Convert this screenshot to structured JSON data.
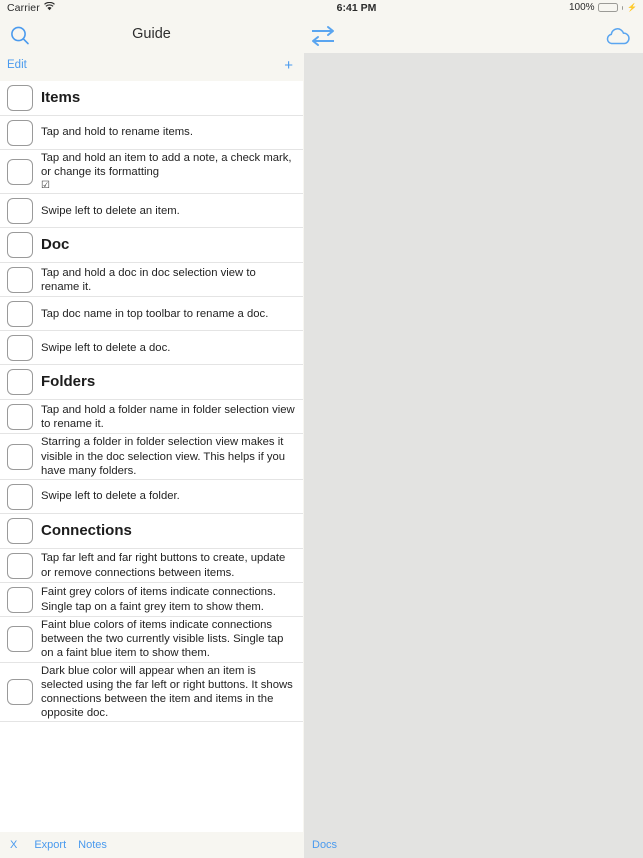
{
  "status_bar": {
    "carrier": "Carrier",
    "wifi_icon": "wifi-icon",
    "time": "6:41 PM",
    "battery_percent": "100%",
    "battery_icon": "battery-full-icon",
    "charging_icon": "charging-bolt-icon"
  },
  "nav_bar": {
    "search_icon": "search-icon",
    "title": "Guide",
    "sync_icon": "sync-arrows-icon",
    "cloud_icon": "cloud-icon"
  },
  "toolbar": {
    "edit_label": "Edit",
    "add_label": "+"
  },
  "colors": {
    "accent_blue": "#4a9aee",
    "background_cream": "#f7f6f1",
    "right_panel_grey": "#e3e3e1",
    "list_white": "#ffffff",
    "divider": "#e4e4e4",
    "battery_green": "#4cd964"
  },
  "list": {
    "rows": [
      {
        "kind": "header",
        "text": "Items"
      },
      {
        "kind": "item",
        "text": "Tap and hold to rename items."
      },
      {
        "kind": "item",
        "text": "Tap and hold an item to add a note, a check mark, or change its formatting",
        "glyph": "☑"
      },
      {
        "kind": "item",
        "text": "Swipe left to delete an item."
      },
      {
        "kind": "header",
        "text": "Doc"
      },
      {
        "kind": "item",
        "text": "Tap and hold a doc in doc selection view to rename it."
      },
      {
        "kind": "item",
        "text": "Tap doc name in top toolbar to rename a doc."
      },
      {
        "kind": "item",
        "text": "Swipe left to delete a doc."
      },
      {
        "kind": "header",
        "text": "Folders"
      },
      {
        "kind": "item",
        "text": "Tap and hold a folder name in folder selection view to rename it."
      },
      {
        "kind": "item",
        "text": "Starring a folder in folder selection view makes it visible in the doc selection view.  This helps if you have many folders."
      },
      {
        "kind": "item",
        "text": "Swipe left to delete a folder."
      },
      {
        "kind": "header",
        "text": "Connections"
      },
      {
        "kind": "item",
        "text": "Tap far left and far right buttons to create, update or remove connections between items."
      },
      {
        "kind": "item",
        "text": "Faint grey colors of items indicate connections.  Single tap on a faint grey item to show them."
      },
      {
        "kind": "item",
        "text": "Faint blue colors of items indicate connections between the two currently visible lists.  Single tap on a faint blue item to show them."
      },
      {
        "kind": "item",
        "text": "Dark blue color will appear when an item is selected using the far left or right buttons.  It shows connections between the item and items in the opposite doc."
      }
    ]
  },
  "bottom_toolbar_left": {
    "close_label": "X",
    "export_label": "Export",
    "notes_label": "Notes"
  },
  "bottom_toolbar_right": {
    "docs_label": "Docs"
  }
}
